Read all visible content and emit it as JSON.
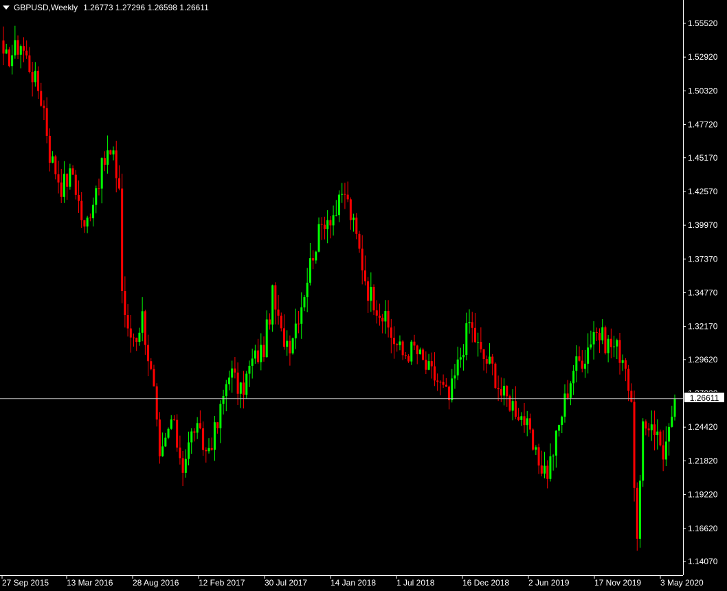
{
  "header": {
    "symbol_label": "GBPUSD,Weekly",
    "ohlc": "1.26773 1.27296 1.26598 1.26611"
  },
  "current_price": "1.26611",
  "colors": {
    "background": "#000000",
    "bull": "#00ff00",
    "bear": "#ff0000",
    "axis": "#ffffff",
    "price_line": "#c0c0c0"
  },
  "chart_data": {
    "type": "candlestick",
    "title": "GBPUSD,Weekly",
    "xlabel": "",
    "ylabel": "",
    "ylim": [
      1.127,
      1.565
    ],
    "x_ticks": [
      "27 Sep 2015",
      "13 Mar 2016",
      "28 Aug 2016",
      "12 Feb 2017",
      "30 Jul 2017",
      "14 Jan 2018",
      "1 Jul 2018",
      "16 Dec 2018",
      "2 Jun 2019",
      "17 Nov 2019",
      "3 May 2020"
    ],
    "y_ticks": [
      "1.55520",
      "1.52920",
      "1.50320",
      "1.47720",
      "1.45170",
      "1.42570",
      "1.39970",
      "1.37370",
      "1.34770",
      "1.32170",
      "1.29620",
      "1.27020",
      "1.24420",
      "1.21820",
      "1.19220",
      "1.16620",
      "1.14070"
    ],
    "y_tick_values": [
      1.5552,
      1.5292,
      1.5032,
      1.4772,
      1.4517,
      1.4257,
      1.3997,
      1.3737,
      1.3477,
      1.3217,
      1.2962,
      1.2702,
      1.2442,
      1.2182,
      1.1922,
      1.1662,
      1.1407
    ],
    "current_value": 1.26611,
    "path_points": [
      [
        0,
        1.525
      ],
      [
        6,
        1.54
      ],
      [
        12,
        1.505
      ],
      [
        14,
        1.49
      ],
      [
        16,
        1.455
      ],
      [
        20,
        1.43
      ],
      [
        24,
        1.44
      ],
      [
        28,
        1.395
      ],
      [
        32,
        1.43
      ],
      [
        36,
        1.455
      ],
      [
        38,
        1.45
      ],
      [
        40,
        1.43
      ],
      [
        41,
        1.35
      ],
      [
        43,
        1.315
      ],
      [
        46,
        1.315
      ],
      [
        48,
        1.33
      ],
      [
        50,
        1.3
      ],
      [
        52,
        1.27
      ],
      [
        54,
        1.215
      ],
      [
        58,
        1.25
      ],
      [
        62,
        1.215
      ],
      [
        66,
        1.245
      ],
      [
        70,
        1.225
      ],
      [
        74,
        1.245
      ],
      [
        78,
        1.29
      ],
      [
        82,
        1.27
      ],
      [
        86,
        1.295
      ],
      [
        90,
        1.305
      ],
      [
        93,
        1.345
      ],
      [
        96,
        1.315
      ],
      [
        99,
        1.31
      ],
      [
        103,
        1.34
      ],
      [
        107,
        1.38
      ],
      [
        111,
        1.405
      ],
      [
        115,
        1.41
      ],
      [
        118,
        1.425
      ],
      [
        122,
        1.39
      ],
      [
        126,
        1.35
      ],
      [
        130,
        1.335
      ],
      [
        134,
        1.315
      ],
      [
        138,
        1.3
      ],
      [
        142,
        1.305
      ],
      [
        146,
        1.29
      ],
      [
        150,
        1.28
      ],
      [
        154,
        1.265
      ],
      [
        158,
        1.3
      ],
      [
        161,
        1.325
      ],
      [
        165,
        1.3
      ],
      [
        169,
        1.29
      ],
      [
        172,
        1.27
      ],
      [
        176,
        1.262
      ],
      [
        180,
        1.25
      ],
      [
        184,
        1.22
      ],
      [
        188,
        1.21
      ],
      [
        191,
        1.235
      ],
      [
        194,
        1.265
      ],
      [
        197,
        1.29
      ],
      [
        201,
        1.3
      ],
      [
        204,
        1.32
      ],
      [
        208,
        1.31
      ],
      [
        212,
        1.305
      ],
      [
        215,
        1.295
      ],
      [
        217,
        1.255
      ],
      [
        219,
        1.155
      ],
      [
        221,
        1.24
      ],
      [
        224,
        1.25
      ],
      [
        228,
        1.225
      ],
      [
        231,
        1.245
      ],
      [
        232,
        1.266
      ]
    ]
  }
}
